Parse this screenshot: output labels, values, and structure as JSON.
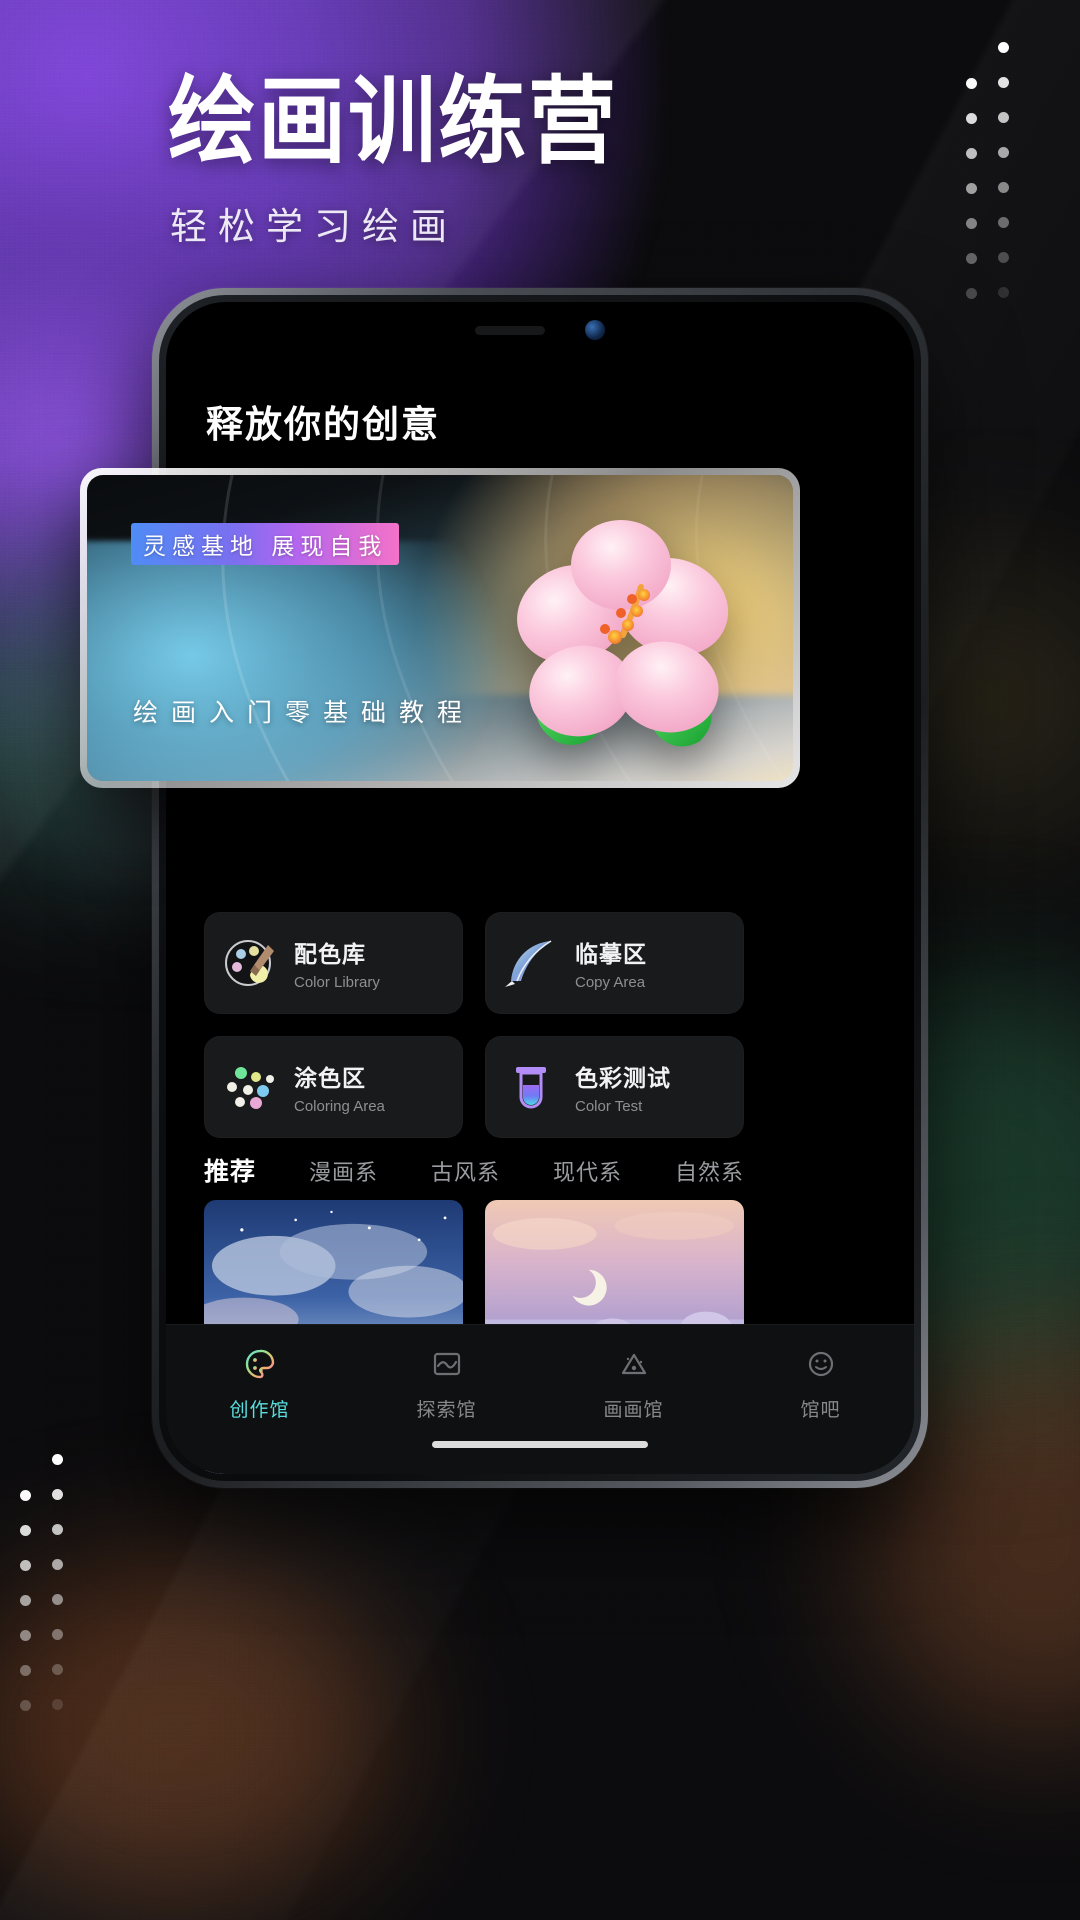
{
  "promo": {
    "headline": "绘画训练营",
    "subheadline": "轻松学习绘画"
  },
  "colors": {
    "accent_purple": "#7a3fd6",
    "accent_cyan": "#58e0df",
    "badge_gradient_start": "#4f8cf5",
    "badge_gradient_mid": "#b466ee",
    "badge_gradient_end": "#f472c8",
    "card_bg": "#191a1c",
    "screen_bg": "#000000"
  },
  "phone": {
    "screen_title": "释放你的创意",
    "hero_card": {
      "badge": "灵感基地 展现自我",
      "caption": "绘画入门零基础教程",
      "image": "hibiscus-flower-emoji"
    },
    "feature_cards": [
      {
        "title": "配色库",
        "subtitle": "Color Library",
        "icon": "palette-icon"
      },
      {
        "title": "临摹区",
        "subtitle": "Copy Area",
        "icon": "feather-quill-icon"
      },
      {
        "title": "涂色区",
        "subtitle": "Coloring Area",
        "icon": "color-dots-icon"
      },
      {
        "title": "色彩测试",
        "subtitle": "Color Test",
        "icon": "test-tube-icon"
      }
    ],
    "category_tabs": [
      {
        "label": "推荐",
        "active": true
      },
      {
        "label": "漫画系",
        "active": false
      },
      {
        "label": "古风系",
        "active": false
      },
      {
        "label": "现代系",
        "active": false
      },
      {
        "label": "自然系",
        "active": false
      }
    ],
    "gallery": [
      {
        "name": "ocean-boat-night-sky-artwork"
      },
      {
        "name": "purple-santorini-town-artwork"
      }
    ],
    "bottom_nav": [
      {
        "label": "创作馆",
        "icon": "palette-nav-icon",
        "active": true
      },
      {
        "label": "探索馆",
        "icon": "landscape-nav-icon",
        "active": false
      },
      {
        "label": "画画馆",
        "icon": "triangle-nav-icon",
        "active": false
      },
      {
        "label": "馆吧",
        "icon": "smiley-nav-icon",
        "active": false
      }
    ]
  },
  "decor": {
    "dot_columns": 4,
    "dots_per_column": 8
  }
}
